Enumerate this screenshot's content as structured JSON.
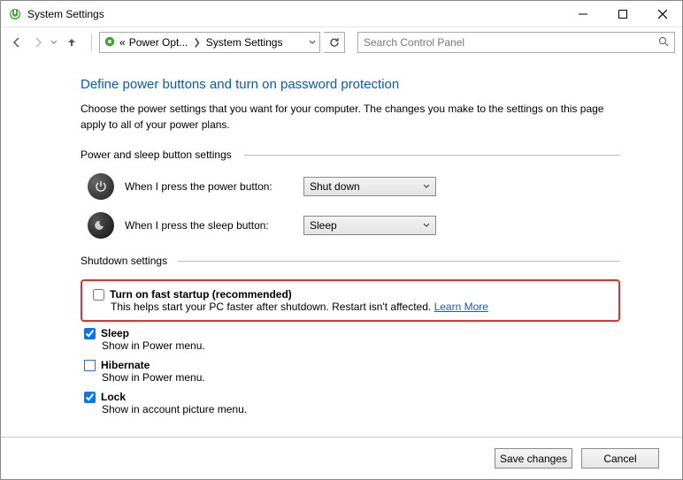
{
  "window": {
    "title": "System Settings"
  },
  "breadcrumb": {
    "prefix": "«",
    "item1": "Power Opt...",
    "item2": "System Settings"
  },
  "search": {
    "placeholder": "Search Control Panel"
  },
  "page": {
    "title": "Define power buttons and turn on password protection",
    "description": "Choose the power settings that you want for your computer. The changes you make to the settings on this page apply to all of your power plans."
  },
  "section_buttons": {
    "header": "Power and sleep button settings",
    "power_label": "When I press the power button:",
    "power_value": "Shut down",
    "sleep_label": "When I press the sleep button:",
    "sleep_value": "Sleep"
  },
  "section_shutdown": {
    "header": "Shutdown settings",
    "fast_startup": {
      "checked": false,
      "title": "Turn on fast startup (recommended)",
      "desc": "This helps start your PC faster after shutdown. Restart isn't affected. ",
      "learn_more": "Learn More"
    },
    "sleep": {
      "checked": true,
      "title": "Sleep",
      "desc": "Show in Power menu."
    },
    "hibernate": {
      "checked": false,
      "title": "Hibernate",
      "desc": "Show in Power menu."
    },
    "lock": {
      "checked": true,
      "title": "Lock",
      "desc": "Show in account picture menu."
    }
  },
  "footer": {
    "save": "Save changes",
    "cancel": "Cancel"
  }
}
